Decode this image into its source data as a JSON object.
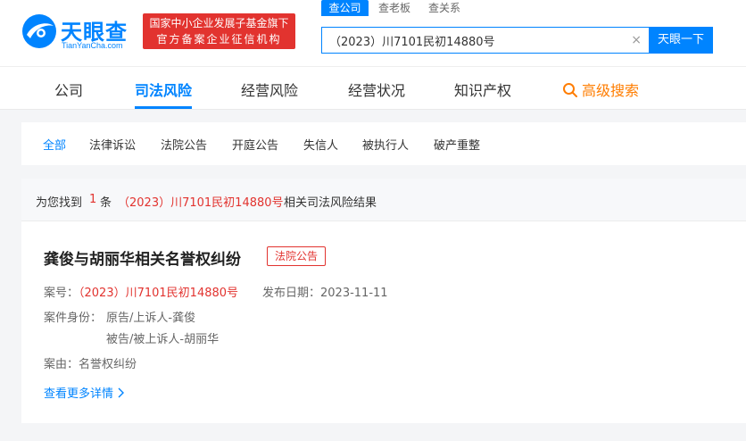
{
  "header": {
    "logo": {
      "name_cn": "天眼查",
      "name_en": "TianYanCha.com"
    },
    "banner": {
      "line1": "国家中小企业发展子基金旗下",
      "line2": "官方备案企业征信机构"
    },
    "search_tabs": [
      "查公司",
      "查老板",
      "查关系"
    ],
    "search": {
      "value": "（2023）川7101民初14880号",
      "button": "天眼一下"
    }
  },
  "nav": {
    "items": [
      "公司",
      "司法风险",
      "经营风险",
      "经营状况",
      "知识产权"
    ],
    "advanced": "高级搜索"
  },
  "filter": {
    "items": [
      "全部",
      "法律诉讼",
      "法院公告",
      "开庭公告",
      "失信人",
      "被执行人",
      "破产重整"
    ]
  },
  "result": {
    "prefix": "为您找到",
    "count": "1",
    "unit": "条",
    "keyword": "（2023）川7101民初14880号",
    "suffix": "相关司法风险结果"
  },
  "card": {
    "title": "龚俊与胡丽华相关名誉权纠纷",
    "tag": "法院公告",
    "case_no_label": "案号：",
    "case_no": "（2023）川7101民初14880号",
    "date_label": "发布日期：",
    "date": "2023-11-11",
    "identity_label": "案件身份：",
    "identity_1": "原告/上诉人-龚俊",
    "identity_2": "被告/被上诉人-胡丽华",
    "cause_label": "案由：",
    "cause": "名誉权纠纷",
    "more": "查看更多详情"
  },
  "colors": {
    "brand": "#0084ff",
    "alert": "#e2332f",
    "accent": "#ff7d00"
  }
}
